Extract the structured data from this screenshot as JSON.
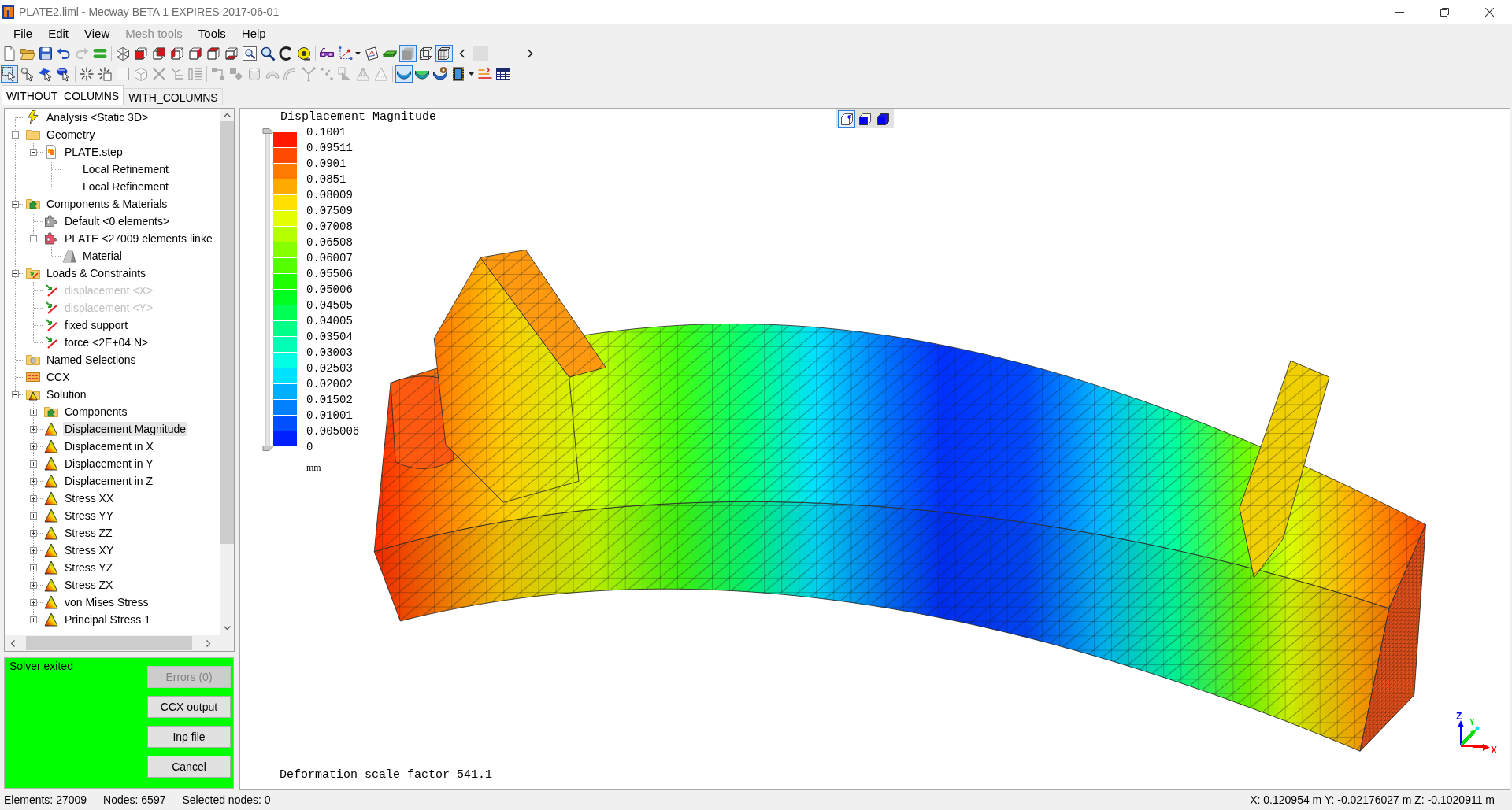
{
  "window": {
    "title": "PLATE2.liml - Mecway BETA 1 EXPIRES 2017-06-01"
  },
  "menu": [
    {
      "label": "File",
      "disabled": false
    },
    {
      "label": "Edit",
      "disabled": false
    },
    {
      "label": "View",
      "disabled": false
    },
    {
      "label": "Mesh tools",
      "disabled": true
    },
    {
      "label": "Tools",
      "disabled": false
    },
    {
      "label": "Help",
      "disabled": false
    }
  ],
  "toolbar": [
    [
      [
        {
          "kind": "button",
          "pressed": false,
          "disabled": false
        },
        {
          "kind": "button",
          "pressed": false,
          "disabled": false
        },
        {
          "kind": "button",
          "pressed": false,
          "disabled": false
        },
        {
          "kind": "button",
          "pressed": false,
          "disabled": false
        },
        {
          "kind": "button",
          "pressed": false,
          "disabled": true
        },
        {
          "kind": "button",
          "pressed": false,
          "disabled": false
        }
      ],
      [
        {
          "kind": "button",
          "pressed": false,
          "disabled": false
        },
        {
          "kind": "button",
          "pressed": false,
          "disabled": false
        },
        {
          "kind": "button",
          "pressed": false,
          "disabled": false
        },
        {
          "kind": "button",
          "pressed": false,
          "disabled": false
        },
        {
          "kind": "button",
          "pressed": false,
          "disabled": false
        },
        {
          "kind": "button",
          "pressed": false,
          "disabled": false
        },
        {
          "kind": "button",
          "pressed": false,
          "disabled": false
        },
        {
          "kind": "button",
          "pressed": false,
          "disabled": false
        },
        {
          "kind": "button",
          "pressed": false,
          "disabled": false
        },
        {
          "kind": "button",
          "pressed": false,
          "disabled": false
        },
        {
          "kind": "button",
          "pressed": false,
          "disabled": false
        }
      ],
      [
        {
          "kind": "button",
          "pressed": false,
          "disabled": false
        },
        {
          "kind": "dropdown",
          "pressed": false,
          "disabled": false
        },
        {
          "kind": "button",
          "pressed": false,
          "disabled": false
        },
        {
          "kind": "button",
          "pressed": false,
          "disabled": false
        },
        {
          "kind": "button",
          "pressed": true,
          "disabled": false
        },
        {
          "kind": "button",
          "pressed": false,
          "disabled": false
        },
        {
          "kind": "button",
          "pressed": true,
          "disabled": false
        },
        {
          "kind": "button",
          "pressed": false,
          "disabled": false
        },
        {
          "kind": "button",
          "pressed": false,
          "disabled": true
        },
        {
          "kind": "button",
          "pressed": false,
          "disabled": false
        }
      ]
    ],
    [
      [
        {
          "kind": "button",
          "pressed": true,
          "disabled": false
        },
        {
          "kind": "button",
          "pressed": false,
          "disabled": false
        },
        {
          "kind": "button",
          "pressed": false,
          "disabled": false
        },
        {
          "kind": "button",
          "pressed": false,
          "disabled": false
        }
      ],
      [
        {
          "kind": "button",
          "pressed": false,
          "disabled": false
        },
        {
          "kind": "button",
          "pressed": false,
          "disabled": false
        },
        {
          "kind": "button",
          "pressed": false,
          "disabled": true
        },
        {
          "kind": "button",
          "pressed": false,
          "disabled": true
        },
        {
          "kind": "button",
          "pressed": false,
          "disabled": true
        },
        {
          "kind": "button",
          "pressed": false,
          "disabled": true
        },
        {
          "kind": "button",
          "pressed": false,
          "disabled": true
        }
      ],
      [
        {
          "kind": "button",
          "pressed": false,
          "disabled": true
        },
        {
          "kind": "button",
          "pressed": false,
          "disabled": true
        },
        {
          "kind": "button",
          "pressed": false,
          "disabled": true
        },
        {
          "kind": "button",
          "pressed": false,
          "disabled": true
        },
        {
          "kind": "button",
          "pressed": false,
          "disabled": true
        },
        {
          "kind": "button",
          "pressed": false,
          "disabled": true
        },
        {
          "kind": "button",
          "pressed": false,
          "disabled": true
        },
        {
          "kind": "button",
          "pressed": false,
          "disabled": true
        },
        {
          "kind": "button",
          "pressed": false,
          "disabled": true
        },
        {
          "kind": "button",
          "pressed": false,
          "disabled": true
        }
      ],
      [
        {
          "kind": "button",
          "pressed": true,
          "disabled": false
        },
        {
          "kind": "button",
          "pressed": false,
          "disabled": false
        },
        {
          "kind": "button",
          "pressed": false,
          "disabled": false
        },
        {
          "kind": "dropdown",
          "pressed": false,
          "disabled": false
        },
        {
          "kind": "button",
          "pressed": false,
          "disabled": false
        },
        {
          "kind": "button",
          "pressed": false,
          "disabled": false
        }
      ]
    ]
  ],
  "tabs": [
    {
      "label": "WITHOUT_COLUMNS",
      "selected": true
    },
    {
      "label": "WITH_COLUMNS",
      "selected": false
    }
  ],
  "tree": [
    {
      "label": "Analysis <Static 3D>",
      "kind": "analysis",
      "selected": false,
      "disabled": false
    },
    {
      "label": "Geometry",
      "kind": "folder",
      "selected": false,
      "disabled": false,
      "expanded": true,
      "children": [
        {
          "label": "PLATE.step",
          "kind": "geometry",
          "selected": false,
          "disabled": false,
          "expanded": true,
          "children": [
            {
              "label": "Local Refinement",
              "kind": "refinement",
              "selected": false,
              "disabled": false
            },
            {
              "label": "Local Refinement",
              "kind": "refinement",
              "selected": false,
              "disabled": false
            }
          ]
        }
      ]
    },
    {
      "label": "Components & Materials",
      "kind": "components",
      "selected": false,
      "disabled": false,
      "expanded": true,
      "children": [
        {
          "label": "Default <0 elements>",
          "kind": "component",
          "color": "#a6a6a6",
          "selected": false,
          "disabled": false
        },
        {
          "label": "PLATE <27009 elements linke",
          "kind": "component",
          "color": "#e8506a",
          "selected": false,
          "disabled": false,
          "expanded": true,
          "children": [
            {
              "label": "Material",
              "kind": "material",
              "selected": false,
              "disabled": false
            }
          ]
        }
      ]
    },
    {
      "label": "Loads & Constraints",
      "kind": "loads",
      "selected": false,
      "disabled": false,
      "expanded": true,
      "children": [
        {
          "label": "displacement <X>",
          "kind": "load",
          "selected": false,
          "disabled": true
        },
        {
          "label": "displacement <Y>",
          "kind": "load",
          "selected": false,
          "disabled": true
        },
        {
          "label": "fixed support",
          "kind": "load",
          "selected": false,
          "disabled": false
        },
        {
          "label": "force <2E+04 N>",
          "kind": "load",
          "selected": false,
          "disabled": false
        }
      ]
    },
    {
      "label": "Named Selections",
      "kind": "selections",
      "selected": false,
      "disabled": false
    },
    {
      "label": "CCX",
      "kind": "solver",
      "selected": false,
      "disabled": false
    },
    {
      "label": "Solution",
      "kind": "solution",
      "selected": false,
      "disabled": false,
      "expanded": true,
      "children": [
        {
          "label": "Components",
          "kind": "components",
          "selected": false,
          "disabled": false,
          "expanded": false
        },
        {
          "label": "Displacement Magnitude",
          "kind": "result",
          "selected": true,
          "disabled": false,
          "expanded": false
        },
        {
          "label": "Displacement in X",
          "kind": "result",
          "selected": false,
          "disabled": false,
          "expanded": false
        },
        {
          "label": "Displacement in Y",
          "kind": "result",
          "selected": false,
          "disabled": false,
          "expanded": false
        },
        {
          "label": "Displacement in Z",
          "kind": "result",
          "selected": false,
          "disabled": false,
          "expanded": false
        },
        {
          "label": "Stress XX",
          "kind": "result",
          "selected": false,
          "disabled": false,
          "expanded": false
        },
        {
          "label": "Stress YY",
          "kind": "result",
          "selected": false,
          "disabled": false,
          "expanded": false
        },
        {
          "label": "Stress ZZ",
          "kind": "result",
          "selected": false,
          "disabled": false,
          "expanded": false
        },
        {
          "label": "Stress XY",
          "kind": "result",
          "selected": false,
          "disabled": false,
          "expanded": false
        },
        {
          "label": "Stress YZ",
          "kind": "result",
          "selected": false,
          "disabled": false,
          "expanded": false
        },
        {
          "label": "Stress ZX",
          "kind": "result",
          "selected": false,
          "disabled": false,
          "expanded": false
        },
        {
          "label": "von Mises Stress",
          "kind": "result",
          "selected": false,
          "disabled": false,
          "expanded": false
        },
        {
          "label": "Principal Stress 1",
          "kind": "result",
          "selected": false,
          "disabled": false,
          "expanded": false
        }
      ]
    }
  ],
  "solver": {
    "status": "Solver exited",
    "buttons": [
      {
        "label": "Errors (0)",
        "disabled": true
      },
      {
        "label": "CCX output",
        "disabled": false
      },
      {
        "label": "Inp file",
        "disabled": false
      },
      {
        "label": "Cancel",
        "disabled": false
      }
    ]
  },
  "viewport": {
    "view_buttons": [
      {
        "selected": true
      },
      {
        "selected": false
      },
      {
        "selected": false
      }
    ],
    "legend": {
      "title": "Displacement Magnitude",
      "swatches": [
        {
          "color": "#ff1a00"
        },
        {
          "color": "#ff4a00"
        },
        {
          "color": "#ff7a00"
        },
        {
          "color": "#ffaa00"
        },
        {
          "color": "#ffe000"
        },
        {
          "color": "#e4ff00"
        },
        {
          "color": "#b4ff00"
        },
        {
          "color": "#86ff00"
        },
        {
          "color": "#55ff00"
        },
        {
          "color": "#20ff00"
        },
        {
          "color": "#00ff20"
        },
        {
          "color": "#00ff55"
        },
        {
          "color": "#00ff86"
        },
        {
          "color": "#00ffb4"
        },
        {
          "color": "#00ffe4"
        },
        {
          "color": "#00e0ff"
        },
        {
          "color": "#00b0ff"
        },
        {
          "color": "#0080ff"
        },
        {
          "color": "#0050ff"
        },
        {
          "color": "#0020ff"
        }
      ],
      "ticks": [
        "0.1001",
        "0.09511",
        "0.0901",
        "0.0851",
        "0.08009",
        "0.07509",
        "0.07008",
        "0.06508",
        "0.06007",
        "0.05506",
        "0.05006",
        "0.04505",
        "0.04005",
        "0.03504",
        "0.03003",
        "0.02503",
        "0.02002",
        "0.01502",
        "0.01001",
        "0.005006",
        "0"
      ],
      "unit": "mm"
    },
    "caption": "Deformation scale factor 541.1",
    "axes": [
      {
        "label": "Z",
        "color": "#0000ff"
      },
      {
        "label": "Y",
        "color": "#00dd00"
      },
      {
        "label": "X",
        "color": "#ff0000"
      }
    ]
  },
  "status_bar": {
    "elements": "Elements: 27009",
    "nodes": "Nodes: 6597",
    "selected_nodes": "Selected nodes: 0",
    "cursor": "X: 0.120954 m Y: -0.02176027 m Z: -0.1020911 m"
  }
}
